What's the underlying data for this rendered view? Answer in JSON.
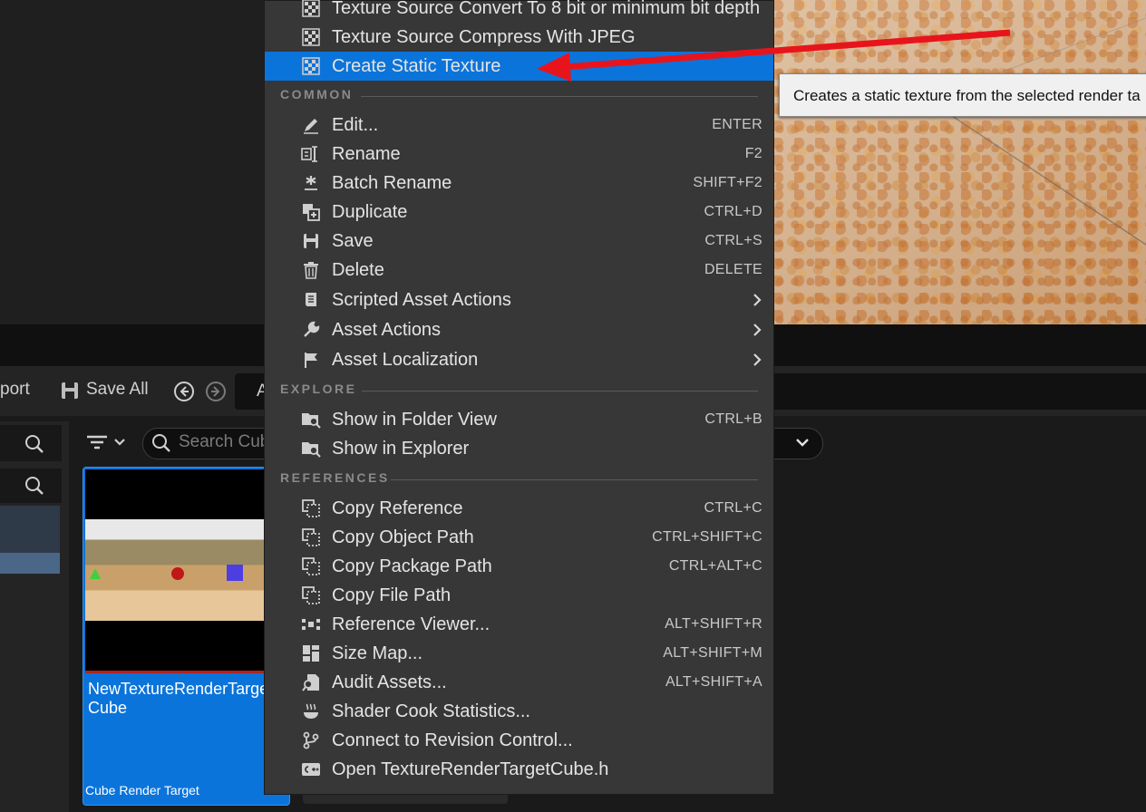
{
  "menu": {
    "top_items": [
      {
        "label": "Texture Source Convert To 8 bit or minimum bit depth",
        "icon": "checker-icon"
      },
      {
        "label": "Texture Source Compress With JPEG",
        "icon": "checker-icon"
      },
      {
        "label": "Create Static Texture",
        "icon": "checker-icon",
        "highlighted": true
      }
    ],
    "sections": {
      "common": "COMMON",
      "explore": "EXPLORE",
      "references": "REFERENCES"
    },
    "common_items": [
      {
        "label": "Edit...",
        "shortcut": "ENTER",
        "icon": "pencil-icon"
      },
      {
        "label": "Rename",
        "shortcut": "F2",
        "icon": "rename-icon"
      },
      {
        "label": "Batch Rename",
        "shortcut": "SHIFT+F2",
        "icon": "asterisk-icon"
      },
      {
        "label": "Duplicate",
        "shortcut": "CTRL+D",
        "icon": "duplicate-icon"
      },
      {
        "label": "Save",
        "shortcut": "CTRL+S",
        "icon": "save-icon"
      },
      {
        "label": "Delete",
        "shortcut": "DELETE",
        "icon": "trash-icon"
      },
      {
        "label": "Scripted Asset Actions",
        "submenu": ">",
        "icon": "script-icon"
      },
      {
        "label": "Asset Actions",
        "submenu": ">",
        "icon": "wrench-icon"
      },
      {
        "label": "Asset Localization",
        "submenu": ">",
        "icon": "flag-icon"
      }
    ],
    "explore_items": [
      {
        "label": "Show in Folder View",
        "shortcut": "CTRL+B",
        "icon": "folder-search-icon"
      },
      {
        "label": "Show in Explorer",
        "shortcut": "",
        "icon": "folder-search-icon"
      }
    ],
    "reference_items": [
      {
        "label": "Copy Reference",
        "shortcut": "CTRL+C",
        "icon": "copy-icon"
      },
      {
        "label": "Copy Object Path",
        "shortcut": "CTRL+SHIFT+C",
        "icon": "copy-icon"
      },
      {
        "label": "Copy Package Path",
        "shortcut": "CTRL+ALT+C",
        "icon": "copy-icon"
      },
      {
        "label": "Copy File Path",
        "shortcut": "",
        "icon": "copy-icon"
      },
      {
        "label": "Reference Viewer...",
        "shortcut": "ALT+SHIFT+R",
        "icon": "graph-icon"
      },
      {
        "label": "Size Map...",
        "shortcut": "ALT+SHIFT+M",
        "icon": "sizemap-icon"
      },
      {
        "label": "Audit Assets...",
        "shortcut": "ALT+SHIFT+A",
        "icon": "audit-icon"
      },
      {
        "label": "Shader Cook Statistics...",
        "shortcut": "",
        "icon": "steam-icon"
      },
      {
        "label": "Connect to Revision Control...",
        "shortcut": "",
        "icon": "branch-icon"
      },
      {
        "label": "Open TextureRenderTargetCube.h",
        "shortcut": "",
        "icon": "cpp-icon"
      }
    ]
  },
  "tooltip": {
    "text": "Creates a static texture from the selected render ta"
  },
  "toolbar": {
    "import_label": "port",
    "save_all_label": "Save All",
    "path_fragment": "A"
  },
  "search": {
    "placeholder": "Search Cub"
  },
  "asset": {
    "name": "NewTextureRenderTargetCube",
    "type": "Cube Render Target"
  },
  "colors": {
    "highlight": "#0b74db",
    "menu_bg": "#373737",
    "arrow": "#e8141c"
  }
}
